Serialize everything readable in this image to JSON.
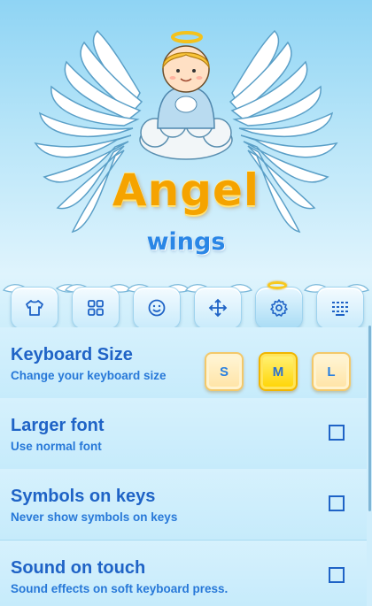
{
  "header": {
    "title": "Angel",
    "subtitle": "wings"
  },
  "toolbar": {
    "items": [
      {
        "label": "shirt-icon"
      },
      {
        "label": "grid-icon"
      },
      {
        "label": "smile-icon"
      },
      {
        "label": "move-icon"
      },
      {
        "label": "gear-icon",
        "active": true
      },
      {
        "label": "keyboard-icon"
      }
    ]
  },
  "settings": {
    "keyboard_size": {
      "title": "Keyboard Size",
      "subtitle": "Change your keyboard size",
      "options": [
        "S",
        "M",
        "L"
      ],
      "selected": "M"
    },
    "larger_font": {
      "title": "Larger font",
      "subtitle": "Use normal font",
      "checked": false
    },
    "symbols_on_keys": {
      "title": "Symbols on keys",
      "subtitle": "Never show symbols on keys",
      "checked": false
    },
    "sound_on_touch": {
      "title": "Sound on touch",
      "subtitle": "Sound effects on soft keyboard press.",
      "checked": false
    }
  },
  "colors": {
    "title_orange": "#f5a300",
    "accent_blue": "#1f63c6",
    "background": "#cfeefc"
  }
}
